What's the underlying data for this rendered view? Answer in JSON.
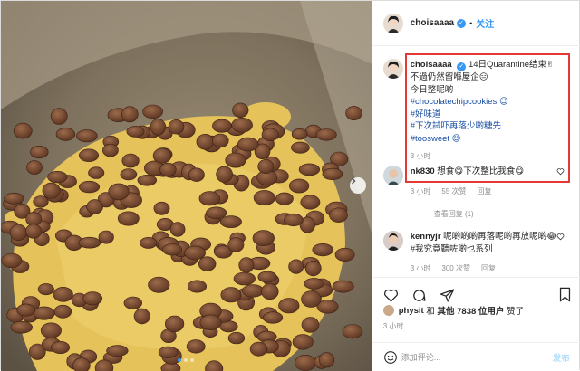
{
  "header": {
    "username": "choisaaaa",
    "separator": "•",
    "follow_label": "关注"
  },
  "caption": {
    "username": "choisaaaa",
    "lines": [
      "14日Quarantine结束✌",
      "不過仍然留喺屋企😑",
      "今日整呢啲"
    ],
    "hashtags": [
      "#chocolatechipcookies 😉",
      "#好味道",
      "#下次試吓再落少啲糖先",
      "#toosweet 😊"
    ],
    "time": "3 小时"
  },
  "comments": [
    {
      "username": "nk830",
      "text": "想食😋下次整比我食😋",
      "time": "3 小时",
      "likes": "55 次赞",
      "reply_label": "回复"
    },
    {
      "username": "kennyjr",
      "text": "呢啲啲啲再落呢啲再放呢啲😂 #我究竟聽咗啲乜系列",
      "time": "3 小时",
      "likes": "300 次赞",
      "reply_label": "回复"
    }
  ],
  "view_replies": "查看回复 (1)",
  "likes_line": {
    "user": "physit",
    "and_text": "和",
    "others_label": "其他 7838 位用户",
    "suffix": "赞了"
  },
  "post_time": "3 小时",
  "composer": {
    "placeholder": "添加评论...",
    "post_label": "发布"
  },
  "colors": {
    "accent": "#3897f0",
    "highlight_border": "#e53935",
    "hashtag": "#1a4fa3"
  }
}
